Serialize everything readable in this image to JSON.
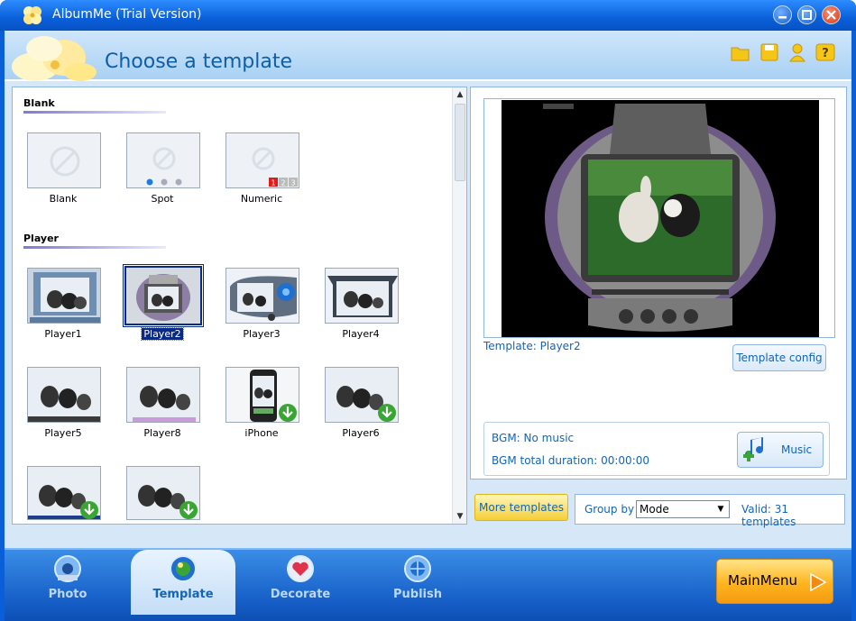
{
  "window": {
    "title": "AlbumMe (Trial Version)"
  },
  "header": {
    "title": "Choose a template",
    "tools": [
      {
        "icon": "folder-open-icon"
      },
      {
        "icon": "save-icon"
      },
      {
        "icon": "user-icon"
      },
      {
        "icon": "help-icon"
      }
    ]
  },
  "templates": {
    "sections": [
      {
        "label": "Blank",
        "items": [
          {
            "label": "Blank",
            "kind": "blank"
          },
          {
            "label": "Spot",
            "kind": "spot"
          },
          {
            "label": "Numeric",
            "kind": "numeric",
            "digits": [
              "1",
              "2",
              "3"
            ]
          }
        ]
      },
      {
        "label": "Player",
        "items": [
          {
            "label": "Player1"
          },
          {
            "label": "Player2",
            "selected": true
          },
          {
            "label": "Player3"
          },
          {
            "label": "Player4"
          },
          {
            "label": "Player5"
          },
          {
            "label": "Player8"
          },
          {
            "label": "iPhone",
            "download": true
          },
          {
            "label": "Player6",
            "download": true
          },
          {
            "label": "",
            "download": true
          },
          {
            "label": "",
            "download": true
          }
        ]
      }
    ]
  },
  "preview": {
    "template_label": "Template:",
    "template_name": "Player2",
    "config_button": "Template config",
    "bgm_label": "BGM:",
    "bgm_value": "No music",
    "bgm_duration_label": "BGM total duration:",
    "bgm_duration": "00:00:00",
    "music_button": "Music"
  },
  "toolbar": {
    "more_templates": "More templates",
    "group_by_label": "Group by",
    "group_by_value": "Mode",
    "valid_text": "Valid: 31 templates"
  },
  "nav": {
    "tabs": [
      {
        "label": "Photo",
        "icon": "photo-icon"
      },
      {
        "label": "Template",
        "icon": "template-icon",
        "active": true
      },
      {
        "label": "Decorate",
        "icon": "decorate-icon"
      },
      {
        "label": "Publish",
        "icon": "publish-icon"
      }
    ],
    "main_menu": "MainMenu"
  },
  "colors": {
    "accent": "#1664b4",
    "titlebar": "#0a5fd8",
    "selection": "#0a2a8a"
  }
}
